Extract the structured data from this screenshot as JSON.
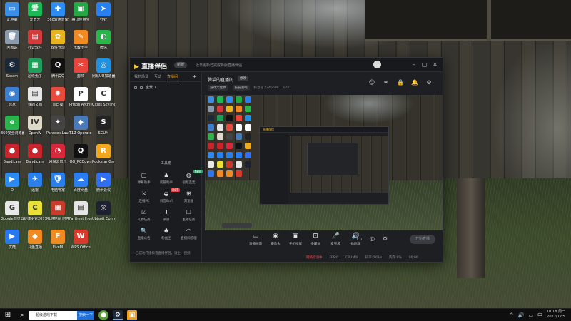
{
  "desktop": {
    "icons": [
      {
        "label": "此电脑",
        "glyph": "▭",
        "color": "#3b8ee8"
      },
      {
        "label": "爱奇艺",
        "glyph": "爱",
        "color": "#19b955"
      },
      {
        "label": "360软件管家",
        "glyph": "✚",
        "color": "#2c8cf2"
      },
      {
        "label": "腾讯应用宝",
        "glyph": "▣",
        "color": "#22a845"
      },
      {
        "label": "钉钉",
        "glyph": "➤",
        "color": "#2a7ff0"
      },
      {
        "label": "回收站",
        "glyph": "🗑",
        "color": "#8a9bb0"
      },
      {
        "label": "办公软件",
        "glyph": "▤",
        "color": "#d23b3b"
      },
      {
        "label": "软件管理",
        "glyph": "✿",
        "color": "#e8b41e"
      },
      {
        "label": "乐教乐学",
        "glyph": "✎",
        "color": "#f08a22"
      },
      {
        "label": "微信",
        "glyph": "◐",
        "color": "#2ab44a"
      },
      {
        "label": "Steam",
        "glyph": "⚙",
        "color": "#1b2838"
      },
      {
        "label": "超级兔子",
        "glyph": "▦",
        "color": "#1f9e5a"
      },
      {
        "label": "腾讯QQ",
        "glyph": "Q",
        "color": "#111111"
      },
      {
        "label": "剪映",
        "glyph": "✂",
        "color": "#e8453c"
      },
      {
        "label": "网易UU加速器",
        "glyph": "◎",
        "color": "#2090e0"
      },
      {
        "label": "恋家",
        "glyph": "◉",
        "color": "#3c7fd0"
      },
      {
        "label": "我的文档",
        "glyph": "▤",
        "color": "#e6e6e6"
      },
      {
        "label": "向日葵",
        "glyph": "✹",
        "color": "#e84b3c"
      },
      {
        "label": "Prison Architect",
        "glyph": "P",
        "color": "#ffffff"
      },
      {
        "label": "Cities Skylines",
        "glyph": "C",
        "color": "#ffffff"
      },
      {
        "label": "360安全浏览器",
        "glyph": "e",
        "color": "#2bb34c"
      },
      {
        "label": "OpenIV",
        "glyph": "IV",
        "color": "#ded8c8"
      },
      {
        "label": "Paradox Launcher v2",
        "glyph": "✦",
        "color": "#444444"
      },
      {
        "label": "T1Z Operator",
        "glyph": "◆",
        "color": "#4a7bb8"
      },
      {
        "label": "SCUM",
        "glyph": "S",
        "color": "#222222"
      },
      {
        "label": "Bandicam",
        "glyph": "●",
        "color": "#c8242c"
      },
      {
        "label": "Bandicam",
        "glyph": "●",
        "color": "#c8242c"
      },
      {
        "label": "网易云音乐",
        "glyph": "◔",
        "color": "#d8283a"
      },
      {
        "label": "QQ_PCDown",
        "glyph": "Q",
        "color": "#111111"
      },
      {
        "label": "Rockstar Games",
        "glyph": "R",
        "color": "#f2a81e"
      },
      {
        "label": "D",
        "glyph": "▶",
        "color": "#2d8bf0"
      },
      {
        "label": "迅雷",
        "glyph": "✈",
        "color": "#2a7fea"
      },
      {
        "label": "电脑管家",
        "glyph": "🛡",
        "color": "#2a7fea"
      },
      {
        "label": "百度网盘",
        "glyph": "☁",
        "color": "#2b7ef0"
      },
      {
        "label": "腾讯会议",
        "glyph": "▶",
        "color": "#2f6ff0"
      },
      {
        "label": "Google浏览器",
        "glyph": "G",
        "color": "#e8e8e8"
      },
      {
        "label": "赛博朋克2077",
        "glyph": "C",
        "color": "#e8e038"
      },
      {
        "label": "RUR地图 附件包",
        "glyph": "▦",
        "color": "#c83a2a"
      },
      {
        "label": "Farthest Frontier",
        "glyph": "▤",
        "color": "#e6e6e6"
      },
      {
        "label": "Ubisoft Connect",
        "glyph": "◎",
        "color": "#1e2230"
      },
      {
        "label": "优酷",
        "glyph": "▶",
        "color": "#2a78f0"
      },
      {
        "label": "斗鱼直播",
        "glyph": "◆",
        "color": "#f08a22"
      },
      {
        "label": "FiveM",
        "glyph": "F",
        "color": "#f08a22"
      },
      {
        "label": "WPS Office",
        "glyph": "W",
        "color": "#d83a2c"
      }
    ]
  },
  "app": {
    "logo": "直播伴侣",
    "version": "新版",
    "title_notice": "近日更新已完成新版直播伴侣",
    "controls": {
      "min": "–",
      "max": "▢",
      "close": "✕"
    },
    "left_tabs": [
      "我的场景",
      "互动",
      "直播间"
    ],
    "left_active_tab": "直播间",
    "add_label": "+",
    "scene_name": "全景 1",
    "toolbox_title": "工具箱",
    "tools": [
      {
        "label": "弹幕助手",
        "glyph": "▢",
        "tag": ""
      },
      {
        "label": "房管助手",
        "glyph": "♟",
        "tag": ""
      },
      {
        "label": "视频连麦",
        "glyph": "◍",
        "tag": "NEW"
      },
      {
        "label": "连线PK",
        "glyph": "⚔",
        "tag": ""
      },
      {
        "label": "抖音Buff",
        "glyph": "◒",
        "tag": "HOT"
      },
      {
        "label": "浏览器",
        "glyph": "⊞",
        "tag": ""
      },
      {
        "label": "礼物任务",
        "glyph": "☑",
        "tag": ""
      },
      {
        "label": "录屏",
        "glyph": "⬇",
        "tag": ""
      },
      {
        "label": "主播任务",
        "glyph": "☐",
        "tag": ""
      },
      {
        "label": "直播公告",
        "glyph": "🔍",
        "tag": ""
      },
      {
        "label": "粉丝团",
        "glyph": "♣",
        "tag": ""
      },
      {
        "label": "直播间管理",
        "glyph": "◠",
        "tag": ""
      }
    ],
    "room": {
      "title": "腾袋的直播间",
      "edit": "修改",
      "category": "游戏大世界",
      "tag": "猫猫酒吧",
      "meta_id": "抖音号 5246609",
      "meta_fans": "172"
    },
    "room_icons": [
      "☺",
      "✉",
      "🔒",
      "🔔",
      "⚙"
    ],
    "controls_bottom": [
      {
        "label": "直播画面",
        "glyph": "▭"
      },
      {
        "label": "摄像头",
        "glyph": "◉"
      },
      {
        "label": "手机投屏",
        "glyph": "▣"
      },
      {
        "label": "多媒体",
        "glyph": "⊡"
      },
      {
        "label": "麦克风",
        "glyph": "🎤"
      },
      {
        "label": "扬声器",
        "glyph": "🔊"
      }
    ],
    "right_icons": [
      "▭",
      "◎",
      "⚙"
    ],
    "start_live": "开始直播",
    "status": {
      "warning": "网络检测中",
      "fps": "FPS:0",
      "cpu": "CPU:4%",
      "bitrate": "码率:0KB/s",
      "mem": "内存:9%",
      "time": "00:00"
    },
    "notice": "已成功开播抖音直播伴侣，请上一视频"
  },
  "taskbar": {
    "start_glyph": "⊞",
    "search_glyph": "⌕",
    "search_text": "超级游戏下载",
    "search_button": "搜索一下",
    "apps": [
      {
        "glyph": "▢",
        "color": "#333333"
      },
      {
        "glyph": "●",
        "color": "#5a9e3c"
      },
      {
        "glyph": "⚙",
        "color": "#1b2838"
      },
      {
        "glyph": "▣",
        "color": "#f0a020"
      }
    ],
    "tray": [
      "^",
      "🔊",
      "▭",
      "中"
    ],
    "time": "10:18 周一",
    "date": "2022/12/5"
  }
}
